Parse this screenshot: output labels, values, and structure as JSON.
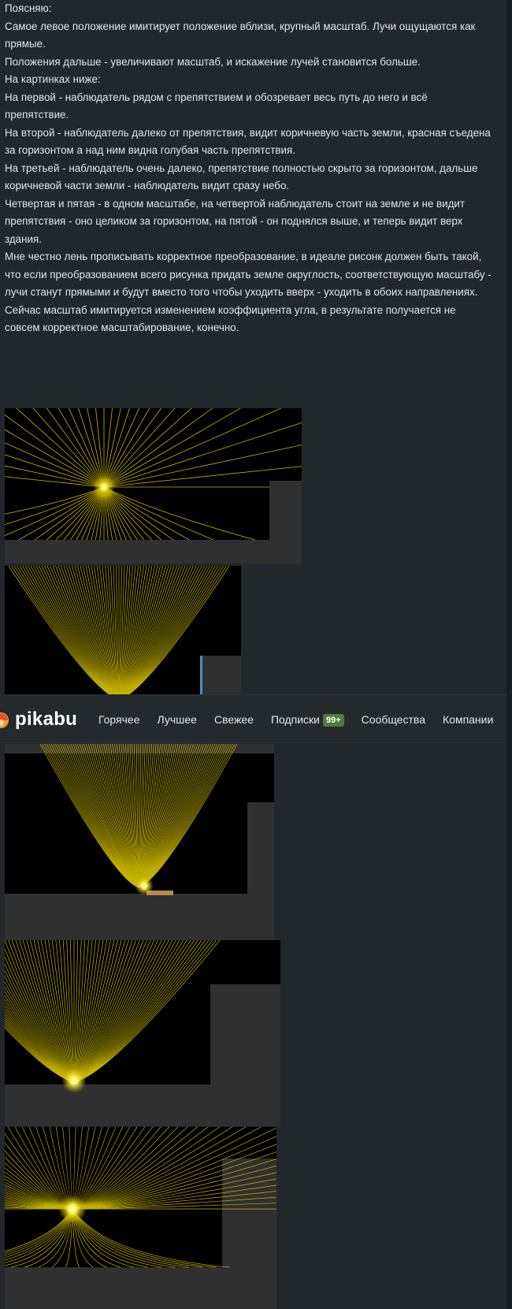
{
  "article": {
    "paragraphs": [
      "Поясняю:",
      "Самое левое положение имитирует положение вблизи, крупный масштаб. Лучи ощущаются как прямые.",
      "Положения дальше - увеличивают масштаб, и искажение лучей становится больше.",
      "",
      "На картинках ниже:",
      "На первой - наблюдатель рядом с препятствием и обозревает весь путь до него и всё препятствие.",
      "На второй - наблюдатель далеко от препятствия, видит коричневую часть земли, красная съедена за горизонтом а над ним видна голубая часть препятствия.",
      "На третьей - наблюдатель очень далеко, препятствие полностью скрыто за горизонтом, дальше коричневой части земли - наблюдатель видит сразу небо.",
      "",
      "",
      "Четвертая и пятая - в одном масштабе, на четвертой наблюдатель стоит на земле и не видит препятствия - оно целиком за горизонтом, на пятой - он поднялся выше, и теперь видит верх здания.",
      "",
      "Мне честно лень прописывать корректное преобразование, в идеале рисонк должен быть такой, что если преобразованием всего рисунка придать земле округлость, соответствующую масштабу - лучи станут прямыми и будут вместо того чтобы уходить вверх - уходить в обоих направлениях. Сейчас масштаб имитируется изменением коэффициента угла, в результате получается не совсем корректное масштабирование, конечно."
    ]
  },
  "header": {
    "logo_text": "pikabu",
    "nav": [
      {
        "label": "Горячее"
      },
      {
        "label": "Лучшее"
      },
      {
        "label": "Свежее"
      },
      {
        "label": "Подписки",
        "badge": "99+"
      },
      {
        "label": "Сообщества"
      },
      {
        "label": "Компании"
      }
    ]
  },
  "colors": {
    "background": "#22272c",
    "ray": "#c8b400",
    "ground": "#303030",
    "badge": "#4f7a3a"
  },
  "icons": [
    "pikabu-logo-icon"
  ]
}
